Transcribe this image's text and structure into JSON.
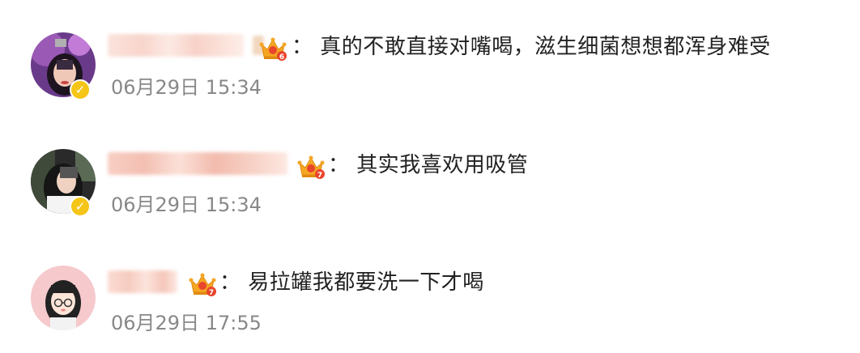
{
  "comments": [
    {
      "text": "： 真的不敢直接对嘴喝，滋生细菌想想都浑身难受",
      "timestamp": "06月29日 15:34",
      "crown_level": "6",
      "verified_mark": "✓"
    },
    {
      "text": "： 其实我喜欢用吸管",
      "timestamp": "06月29日 15:34",
      "crown_level": "7",
      "verified_mark": "✓"
    },
    {
      "text": "： 易拉罐我都要洗一下才喝",
      "timestamp": "06月29日 17:55",
      "crown_level": "7"
    }
  ],
  "colors": {
    "text": "#222222",
    "timestamp": "#888888",
    "verified_badge": "#f5c518",
    "crown": "#f5a623",
    "crown_gem": "#e8452c"
  },
  "icons": {
    "verified": "verified-badge-icon",
    "crown": "vip-crown-icon"
  }
}
